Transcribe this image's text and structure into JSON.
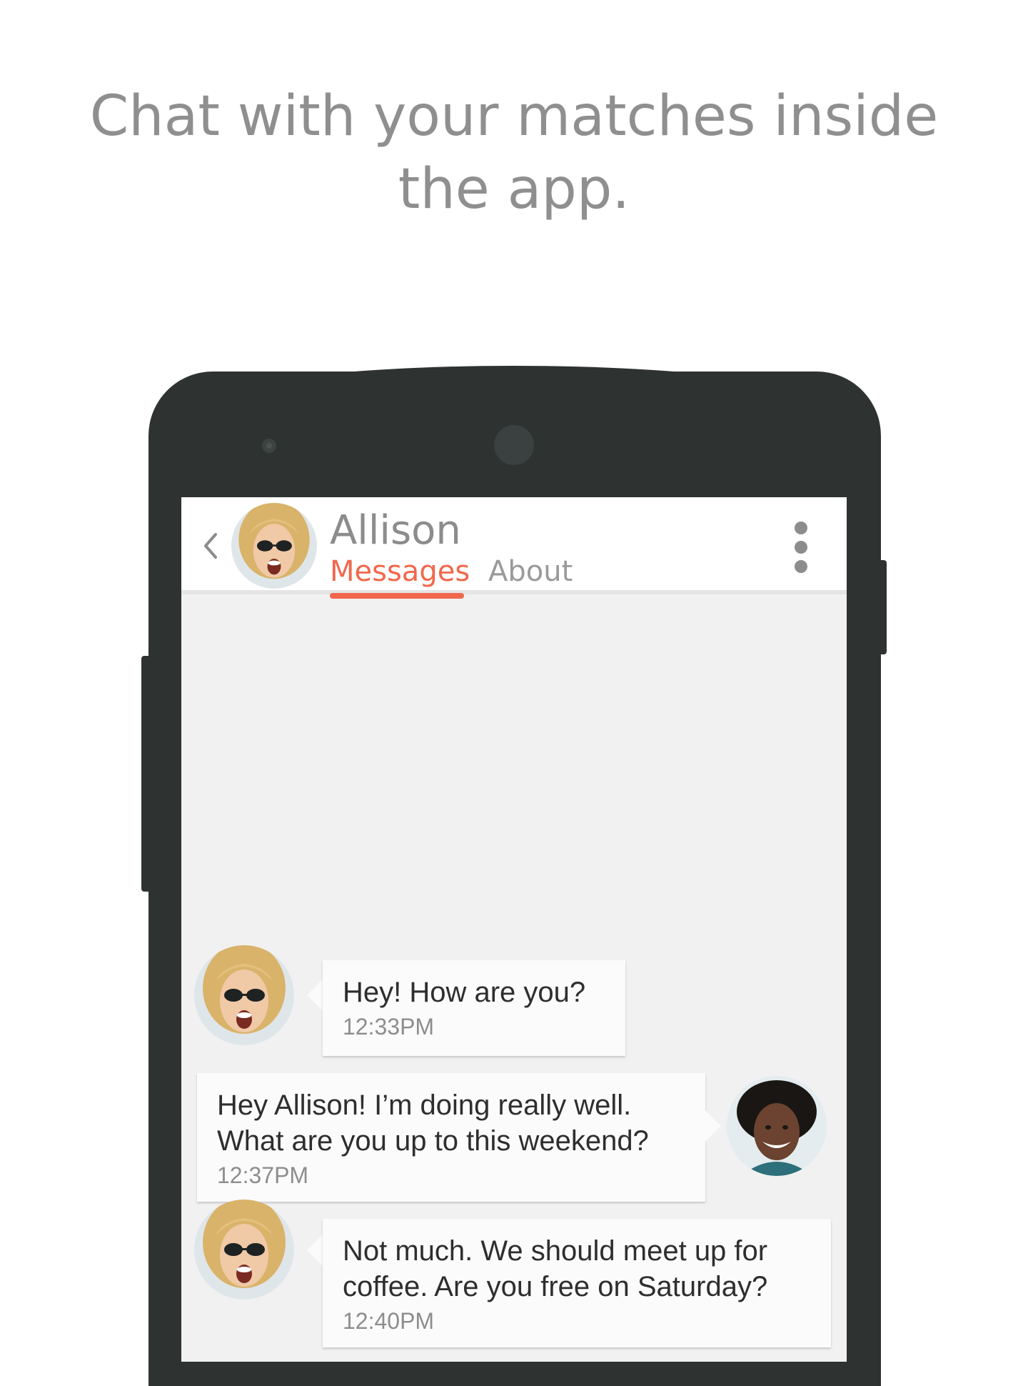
{
  "headline": {
    "line1": "Chat with your matches inside",
    "line2": "the app."
  },
  "chat_header": {
    "back_icon": "chevron-left-icon",
    "contact_name": "Allison",
    "tabs": [
      {
        "label": "Messages",
        "active": true
      },
      {
        "label": "About",
        "active": false
      }
    ],
    "menu_icon": "more-vertical-icon",
    "accent_color": "#f0684c"
  },
  "messages": [
    {
      "sender": "Allison",
      "text_lines": [
        "Hey! How are you?"
      ],
      "time": "12:33PM"
    },
    {
      "sender": "me",
      "text_lines": [
        "Hey Allison! I’m doing really well.",
        "What are you up to this weekend?"
      ],
      "time": "12:37PM"
    },
    {
      "sender": "Allison",
      "text_lines": [
        "Not much. We should meet up for",
        "coffee. Are you free on Saturday?"
      ],
      "time": "12:40PM"
    }
  ]
}
